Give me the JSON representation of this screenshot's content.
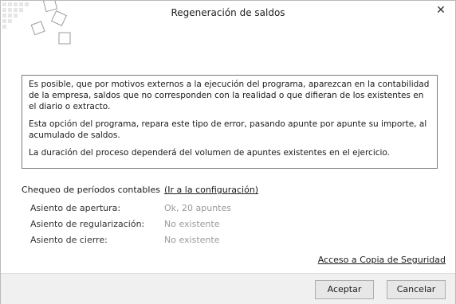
{
  "window": {
    "title": "Regeneración de saldos",
    "close_icon": "close-icon",
    "logo_icon": "diamond-tiles-logo"
  },
  "info": {
    "paragraphs": [
      "Es posible, que por motivos externos a la ejecución del programa, aparezcan en la contabilidad de la empresa, saldos que no corresponden con la realidad o que difieran de los existentes en el diario o extracto.",
      "Esta opción del programa, repara este tipo de error, pasando apunte por apunte su importe, al acumulado de saldos.",
      "La duración del proceso dependerá del volumen de apuntes existentes en el ejercicio."
    ]
  },
  "checks": {
    "title": "Chequeo de períodos contables",
    "config_link": "(Ir a la configuración)",
    "rows": [
      {
        "label": "Asiento de apertura:",
        "value": "Ok, 20 apuntes"
      },
      {
        "label": "Asiento de regularización:",
        "value": "No existente"
      },
      {
        "label": "Asiento de cierre:",
        "value": "No existente"
      }
    ]
  },
  "backup_link": "Acceso a Copia de Seguridad",
  "buttons": {
    "ok": "Aceptar",
    "cancel": "Cancelar"
  }
}
